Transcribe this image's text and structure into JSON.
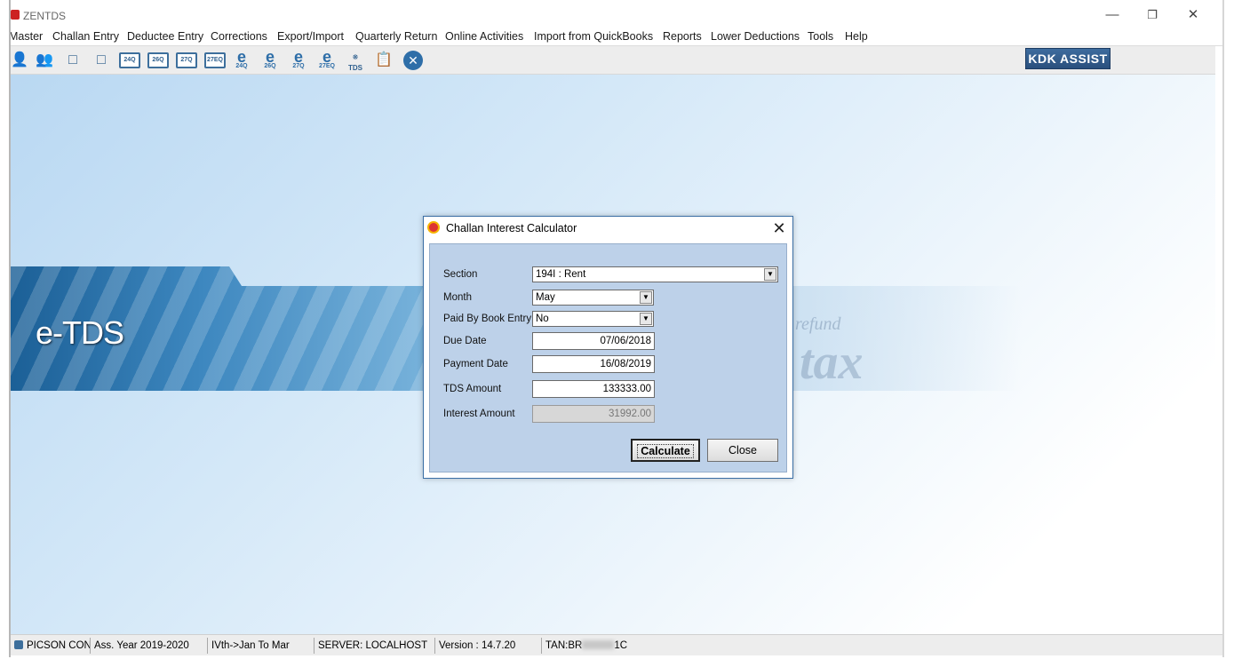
{
  "window": {
    "title": "ZENTDS",
    "minimize": "—",
    "restore": "❐",
    "close": "✕"
  },
  "menu": [
    "Master",
    "Challan Entry",
    "Deductee Entry",
    "Corrections",
    "Export/Import",
    "Quarterly Return",
    "Online Activities",
    "Import from QuickBooks",
    "Reports",
    "Lower Deductions",
    "Tools",
    "Help"
  ],
  "toolbar": {
    "icons": [
      "user-icon",
      "users-icon",
      "deductor-icon",
      "deductee-icon",
      "form-24q-icon",
      "form-26q-icon",
      "form-27q-icon",
      "form-27eq-icon",
      "e-24q-icon",
      "e-26q-icon",
      "e-27q-icon",
      "e-27eq-icon",
      "tds-icon",
      "notes-icon",
      "close-icon"
    ],
    "box_labels": [
      "24Q",
      "26Q",
      "27Q",
      "27EQ"
    ],
    "e_labels": [
      "24Q",
      "26Q",
      "27Q",
      "27EQ"
    ],
    "tds_label": "TDS",
    "kdk_assist": "KDK ASSIST"
  },
  "banner": {
    "title": "e-TDS",
    "watermark": "tax",
    "watermark2": "refund"
  },
  "dialog": {
    "title": "Challan Interest Calculator",
    "section": {
      "label": "Section",
      "value": "194I : Rent"
    },
    "month": {
      "label": "Month",
      "value": "May"
    },
    "paid_by_book_entry": {
      "label": "Paid By Book Entry",
      "value": "No"
    },
    "due_date": {
      "label": "Due Date",
      "value": "07/06/2018"
    },
    "payment_date": {
      "label": "Payment Date",
      "value": "16/08/2019"
    },
    "tds_amount": {
      "label": "TDS Amount",
      "value": "133333.00"
    },
    "interest_amount": {
      "label": "Interest Amount",
      "value": "31992.00"
    },
    "calculate_label": "Calculate",
    "close_label": "Close"
  },
  "statusbar": {
    "company": "PICSON CONS",
    "assessment_year": "Ass. Year 2019-2020",
    "quarter": "IVth->Jan To Mar",
    "server": "SERVER: LOCALHOST",
    "version": "Version : 14.7.20",
    "tan_prefix": "TAN:BR",
    "tan_suffix": "1C"
  }
}
